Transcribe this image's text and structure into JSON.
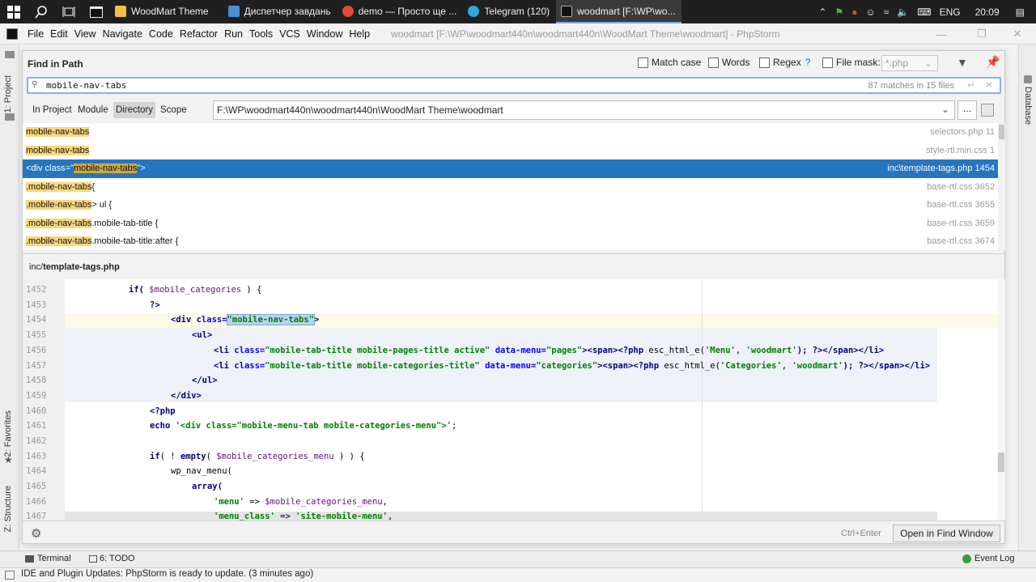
{
  "taskbar": {
    "tasks": [
      {
        "label": "WoodMart Theme",
        "color": "#f2c04a"
      },
      {
        "label": "Диспетчер завдань",
        "color": "#4c8fd6"
      },
      {
        "label": "demo — Просто ще ...",
        "color": "#e04a3a"
      },
      {
        "label": "Telegram (120)",
        "color": "#2ea6e0"
      },
      {
        "label": "woodmart [F:\\WP\\wo...",
        "color": "#5b5b5b"
      }
    ],
    "lang": "ENG",
    "time": "20:09"
  },
  "menubar": {
    "items": [
      "File",
      "Edit",
      "View",
      "Navigate",
      "Code",
      "Refactor",
      "Run",
      "Tools",
      "VCS",
      "Window",
      "Help"
    ],
    "window_title": "woodmart [F:\\WP\\woodmart440n\\woodmart440n\\WoodMart Theme\\woodmart] - PhpStorm"
  },
  "side": {
    "project": "1: Project",
    "favorites": "2: Favorites",
    "structure": "Z: Structure",
    "database": "Database"
  },
  "find": {
    "title": "Find in Path",
    "match_case": "Match case",
    "words": "Words",
    "regex": "Regex",
    "regex_help": "?",
    "file_mask": "File mask:",
    "file_mask_value": "*.php",
    "query": "mobile-nav-tabs",
    "match_count": "87 matches in 15 files",
    "scopes": [
      "In Project",
      "Module",
      "Directory",
      "Scope"
    ],
    "directory": "F:\\WP\\woodmart440n\\woodmart440n\\WoodMart Theme\\woodmart",
    "browse": "...",
    "results": [
      {
        "pre": "",
        "hl": "mobile-nav-tabs",
        "post": "",
        "file": "selectors.php",
        "line": "11"
      },
      {
        "pre": "",
        "hl": "mobile-nav-tabs",
        "post": "",
        "file": "style-rtl.min.css",
        "line": "1"
      },
      {
        "pre": "<div class=\"",
        "hl": "mobile-nav-tabs",
        "post": "\">",
        "file": "inc\\template-tags.php",
        "line": "1454"
      },
      {
        "pre": "",
        "hl": ".mobile-nav-tabs",
        "post": " {",
        "file": "base-rtl.css",
        "line": "3652"
      },
      {
        "pre": "",
        "hl": ".mobile-nav-tabs",
        "post": " > ul {",
        "file": "base-rtl.css",
        "line": "3655"
      },
      {
        "pre": "",
        "hl": ".mobile-nav-tabs",
        "post": " .mobile-tab-title {",
        "file": "base-rtl.css",
        "line": "3659"
      },
      {
        "pre": "",
        "hl": ".mobile-nav-tabs",
        "post": " .mobile-tab-title:after {",
        "file": "base-rtl.css",
        "line": "3674"
      }
    ],
    "preview_dir": "inc/",
    "preview_file": "template-tags.php",
    "shortcut": "Ctrl+Enter",
    "open_button": "Open in Find Window"
  },
  "code": {
    "lines": [
      "1452",
      "1453",
      "1454",
      "1455",
      "1456",
      "1457",
      "1458",
      "1459",
      "1460",
      "1461",
      "1462",
      "1463",
      "1464",
      "1465",
      "1466",
      "1467"
    ],
    "l1452_a": "if( ",
    "l1452_var": "$mobile_categories",
    "l1452_b": " ) {",
    "l1453": "?>",
    "l1454_a": "<div ",
    "l1454_attr": "class=",
    "l1454_q1": "\"",
    "l1454_val": "mobile-nav-tabs",
    "l1454_q2": "\"",
    "l1454_b": ">",
    "l1455": "<ul>",
    "l1456_tag": "<li ",
    "l1456_attr1": "class=",
    "l1456_val1": "\"mobile-tab-title mobile-pages-title active\"",
    "l1456_attr2": " data-menu=",
    "l1456_val2": "\"pages\"",
    "l1456_span": "><span>",
    "l1456_php": "<?php ",
    "l1456_fn": "esc_html_e(",
    "l1456_s1": "'Menu'",
    "l1456_c": ", ",
    "l1456_s2": "'woodmart'",
    "l1456_end": "); ?>",
    "l1456_close": "</span></li>",
    "l1457_tag": "<li ",
    "l1457_attr1": "class=",
    "l1457_val1": "\"mobile-tab-title mobile-categories-title\"",
    "l1457_attr2": " data-menu=",
    "l1457_val2": "\"categories\"",
    "l1457_span": "><span>",
    "l1457_php": "<?php ",
    "l1457_fn": "esc_html_e(",
    "l1457_s1": "'Categories'",
    "l1457_c": ", ",
    "l1457_s2": "'woodmart'",
    "l1457_end": "); ?>",
    "l1457_close": "</span></li>",
    "l1458": "</ul>",
    "l1459": "</div>",
    "l1460": "<?php",
    "l1461_kw": "echo ",
    "l1461_str": "'<div class=\"mobile-menu-tab mobile-categories-menu\">'",
    "l1461_end": ";",
    "l1463_kw": "if",
    "l1463_a": "( ! ",
    "l1463_kw2": "empty",
    "l1463_b": "( ",
    "l1463_var": "$mobile_categories_menu",
    "l1463_c": " ) ) {",
    "l1464": "wp_nav_menu(",
    "l1465": "array(",
    "l1466_s": "'menu'",
    "l1466_op": " => ",
    "l1466_var": "$mobile_categories_menu",
    "l1466_end": ",",
    "l1467_s": "'menu_class'",
    "l1467_op": " => ",
    "l1467_s2": "'site-mobile-menu'",
    "l1467_end": ","
  },
  "toolwindows": {
    "terminal": "Terminal",
    "todo": "6: TODO",
    "event_log": "Event Log"
  },
  "status": "IDE and Plugin Updates: PhpStorm is ready to update. (3 minutes ago)"
}
